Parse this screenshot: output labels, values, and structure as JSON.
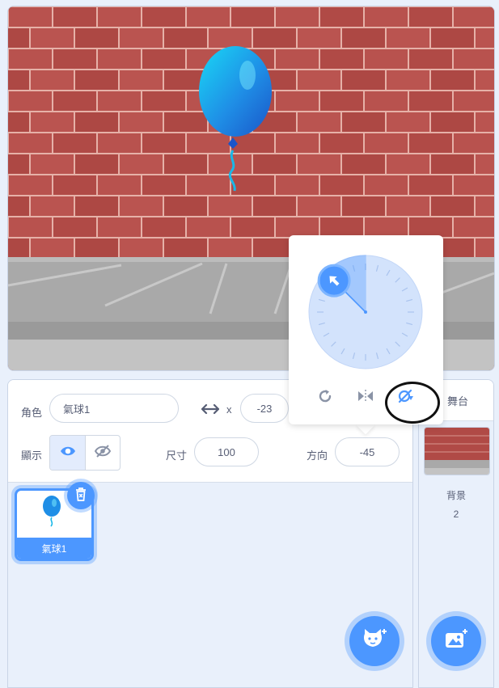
{
  "stage": {
    "sprite_icon": "balloon-sprite"
  },
  "sprite_info": {
    "sprite_label": "角色",
    "sprite_name": "氣球1",
    "x_label": "x",
    "x_value": "-23",
    "show_label": "顯示",
    "size_label": "尺寸",
    "size_value": "100",
    "direction_label": "方向",
    "direction_value": "-45",
    "icons": {
      "xy": "horizontal-arrows-icon",
      "show": "eye-icon",
      "hide": "eye-slash-icon"
    }
  },
  "sprites": [
    {
      "name": "氣球1",
      "selected": true
    }
  ],
  "stage_pane": {
    "title": "舞台",
    "backdrops_label": "背景",
    "backdrops_count": "2"
  },
  "direction_popover": {
    "direction": -45,
    "modes": [
      "all-around-icon",
      "left-right-icon",
      "dont-rotate-icon"
    ],
    "selected_mode": "dont-rotate-icon"
  },
  "colors": {
    "accent": "#4c97ff",
    "panel_bg": "#e9f0fb",
    "text": "#575e75"
  }
}
